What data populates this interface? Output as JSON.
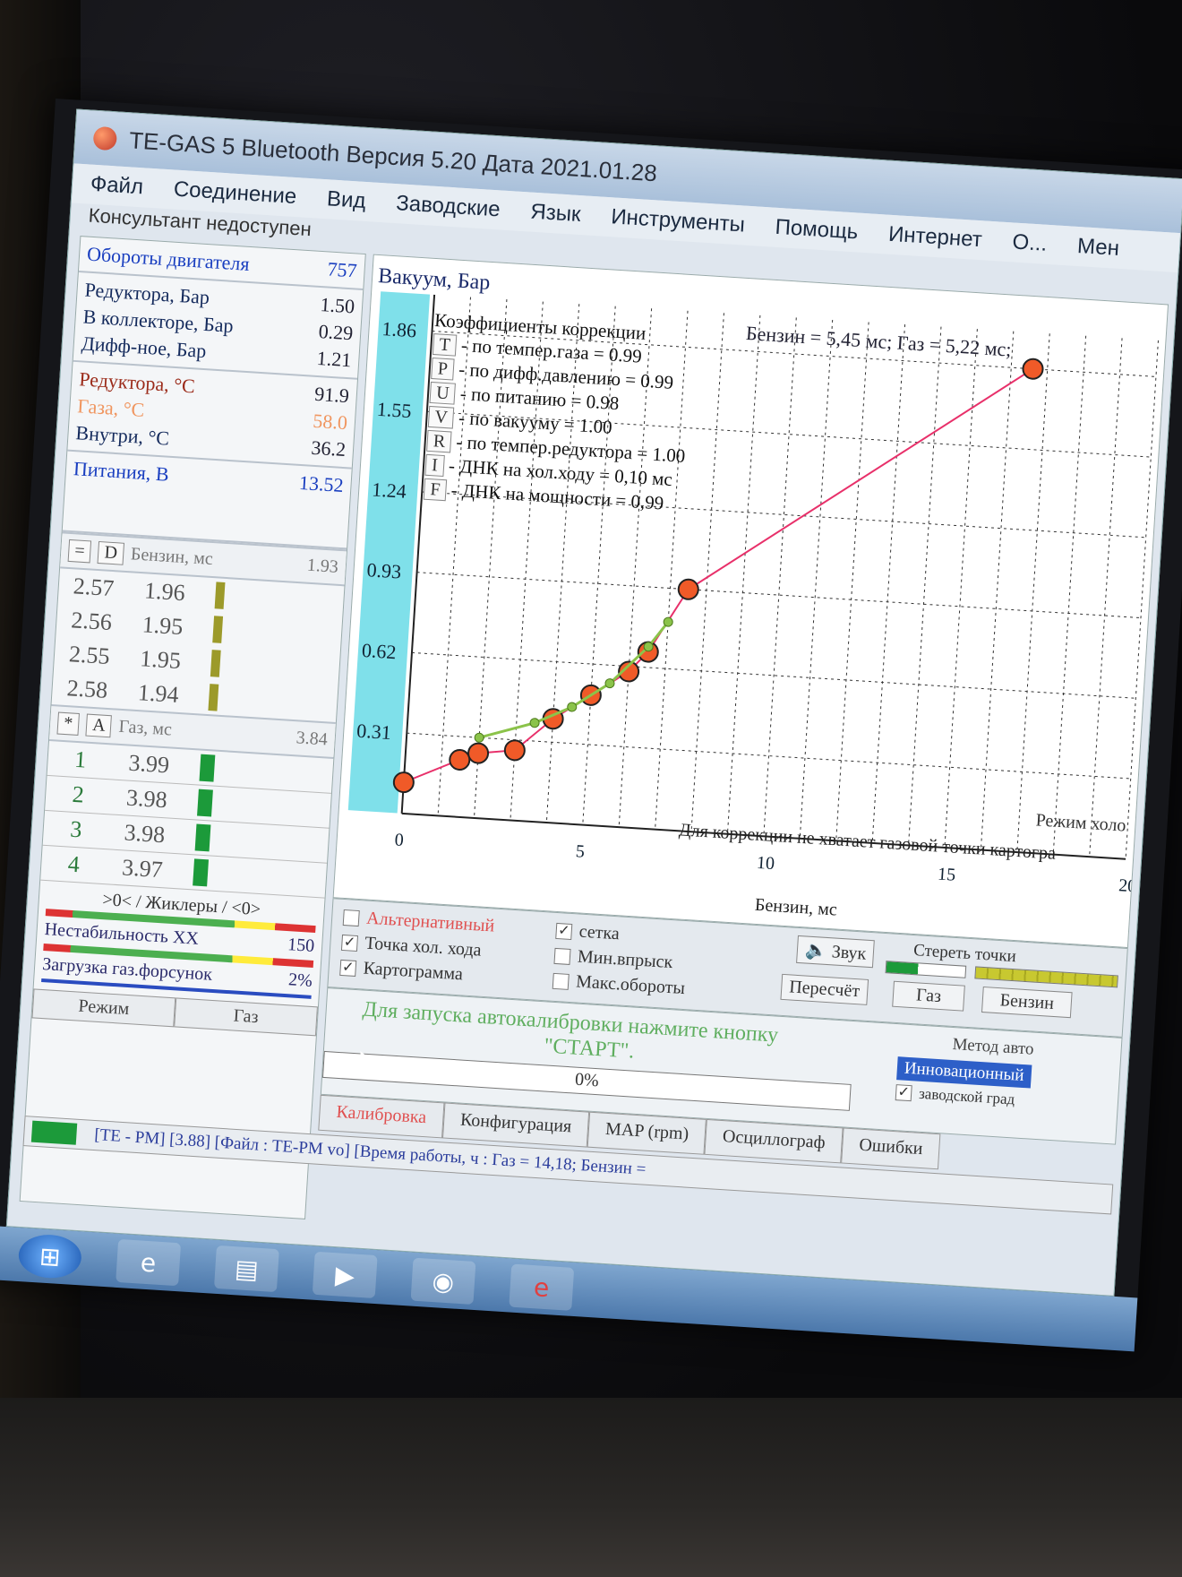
{
  "window": {
    "title": "TE-GAS 5 Bluetooth Версия 5.20  Дата 2021.01.28"
  },
  "menu": [
    {
      "label": "Файл"
    },
    {
      "label": "Соединение"
    },
    {
      "label": "Вид"
    },
    {
      "label": "Заводские"
    },
    {
      "label": "Язык"
    },
    {
      "label": "Инструменты"
    },
    {
      "label": "Помощь"
    },
    {
      "label": "Интернет"
    },
    {
      "label": "О..."
    },
    {
      "label": "Мен"
    }
  ],
  "consultant": "Консультант недоступен",
  "left_panel": {
    "rpm": {
      "label": "Обороты двигателя",
      "value": "757"
    },
    "pressure": [
      {
        "label": "Редуктора, Бар",
        "value": "1.50"
      },
      {
        "label": "В коллекторе, Бар",
        "value": "0.29"
      },
      {
        "label": "Дифф-ное, Бар",
        "value": "1.21"
      }
    ],
    "temps": [
      {
        "label": "Редуктора, °C",
        "value": "91.9"
      },
      {
        "label": "Газа, °C",
        "value": "58.0"
      },
      {
        "label": "Внутри, °C",
        "value": "36.2"
      }
    ],
    "supply": {
      "label": "Питания, В",
      "value": "13.52"
    },
    "petrol_header": {
      "btn1": "=",
      "btn2": "D",
      "label": "Бензин, мс",
      "value": "1.93"
    },
    "petrol_rows": [
      {
        "a": "2.57",
        "b": "1.96"
      },
      {
        "a": "2.56",
        "b": "1.95"
      },
      {
        "a": "2.55",
        "b": "1.95"
      },
      {
        "a": "2.58",
        "b": "1.94"
      }
    ],
    "gas_header": {
      "btn1": "*",
      "btn2": "A",
      "label": "Газ, мс",
      "value": "3.84"
    },
    "gas_rows": [
      {
        "num": "1",
        "val": "3.99"
      },
      {
        "num": "2",
        "val": "3.98"
      },
      {
        "num": "3",
        "val": "3.98"
      },
      {
        "num": "4",
        "val": "3.97"
      }
    ],
    "jets_label": ">0< / Жиклеры / <0>",
    "instability": {
      "label": "Нестабильность ХХ",
      "value": "150"
    },
    "load": {
      "label": "Загрузка газ.форсунок",
      "value": "2%"
    },
    "bottom_buttons": [
      "Режим",
      "Газ"
    ]
  },
  "chart": {
    "title": "Вакуум, Бар",
    "readout": "Бензин = 5,45 мс; Газ = 5,22 мс;",
    "corrections_title": "Коэффициенты коррекции",
    "corrections": [
      {
        "key": "T",
        "text": "- по темпер.газа = 0.99"
      },
      {
        "key": "P",
        "text": "- по дифф.давлению = 0.99"
      },
      {
        "key": "U",
        "text": "- по питанию = 0.98"
      },
      {
        "key": "V",
        "text": "- по вакууму = 1.00"
      },
      {
        "key": "R",
        "text": "- по темпер.редуктора = 1.00"
      },
      {
        "key": "I",
        "text": "- ДНК на хол.ходу = 0,10 мс"
      },
      {
        "key": "F",
        "text": "- ДНК на мощности = 0,99"
      }
    ],
    "mode_note": "Режим холо",
    "warning": "Для коррекции не хватает газовой точки картогра",
    "xlabel": "Бензин, мс"
  },
  "chart_data": {
    "type": "scatter",
    "xlabel": "Бензин, мс",
    "ylabel": "Вакуум, Бар",
    "xlim": [
      0,
      20
    ],
    "ylim": [
      0,
      2.0
    ],
    "x_ticks": [
      0,
      5,
      10,
      15,
      20
    ],
    "y_ticks": [
      0.31,
      0.62,
      0.93,
      1.24,
      1.55,
      1.86
    ],
    "grid": true,
    "series": [
      {
        "points": [
          [
            0,
            0.12
          ],
          [
            1.5,
            0.22
          ],
          [
            2.0,
            0.25
          ],
          [
            3.0,
            0.27
          ],
          [
            4.0,
            0.4
          ],
          [
            5.0,
            0.5
          ],
          [
            6.0,
            0.6
          ],
          [
            6.5,
            0.68
          ],
          [
            7.5,
            0.93
          ],
          [
            16.6,
            1.86
          ]
        ],
        "color": "#e8306a"
      },
      {
        "points": [
          [
            2.0,
            0.31
          ],
          [
            3.5,
            0.38
          ],
          [
            4.5,
            0.45
          ],
          [
            5.5,
            0.55
          ],
          [
            6.5,
            0.7
          ],
          [
            7.0,
            0.8
          ]
        ],
        "color": "#8bc34a"
      }
    ]
  },
  "controls": {
    "alt": "Альтернативный",
    "idle_point": "Точка хол. хода",
    "cartogram": "Картограмма",
    "grid": "сетка",
    "min_inj": "Мин.впрыск",
    "max_rpm": "Макс.обороты",
    "sound": "Звук",
    "recalc": "Пересчёт",
    "clear_points": "Стереть точки",
    "gas_btn": "Газ",
    "petrol_btn": "Бензин"
  },
  "start": {
    "message": "Для запуска автокалибровки нажмите кнопку",
    "button_word": "\"СТАРТ\".",
    "progress": "0%",
    "progress_value": 0,
    "method_label": "Метод авто",
    "method_value": "Инновационный",
    "factory": "заводской град"
  },
  "tabs": [
    "Калибровка",
    "Конфигурация",
    "MAP (rpm)",
    "Осциллограф",
    "Ошибки"
  ],
  "statusbar": "[TE - PM] [3.88] [Файл : TE-PM vo] [Время работы, ч : Газ = 14,18; Бензин ="
}
